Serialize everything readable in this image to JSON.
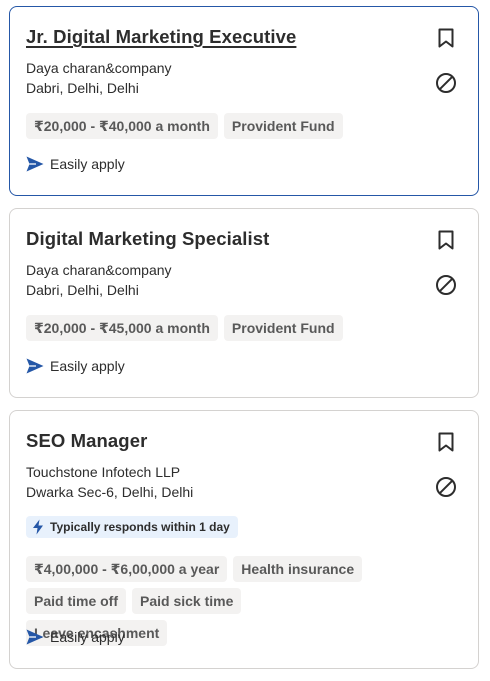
{
  "colors": {
    "accent": "#2557a7",
    "border": "#d4d2d0",
    "chip_bg": "#f3f2f1",
    "responds_bg": "#e8f1fc"
  },
  "jobs": [
    {
      "title": "Jr. Digital Marketing Executive",
      "company": "Daya charan&company",
      "location": "Dabri, Delhi, Delhi",
      "chips": [
        "₹20,000 - ₹40,000 a month",
        "Provident Fund"
      ],
      "apply_label": "Easily apply",
      "selected": true,
      "icons": [
        "bookmark-icon",
        "not-interested-icon",
        "send-icon"
      ]
    },
    {
      "title": "Digital Marketing Specialist",
      "company": "Daya charan&company",
      "location": "Dabri, Delhi, Delhi",
      "chips": [
        "₹20,000 - ₹45,000 a month",
        "Provident Fund"
      ],
      "apply_label": "Easily apply",
      "selected": false,
      "icons": [
        "bookmark-icon",
        "not-interested-icon",
        "send-icon"
      ]
    },
    {
      "title": "SEO Manager",
      "company": "Touchstone Infotech LLP",
      "location": "Dwarka Sec-6, Delhi, Delhi",
      "responds": "Typically responds within 1 day",
      "chips": [
        "₹4,00,000 - ₹6,00,000 a year",
        "Health insurance",
        "Paid time off",
        "Paid sick time",
        "Leave encashment"
      ],
      "apply_label": "Easily apply",
      "selected": false,
      "icons": [
        "bookmark-icon",
        "not-interested-icon",
        "lightning-icon",
        "send-icon"
      ]
    }
  ]
}
